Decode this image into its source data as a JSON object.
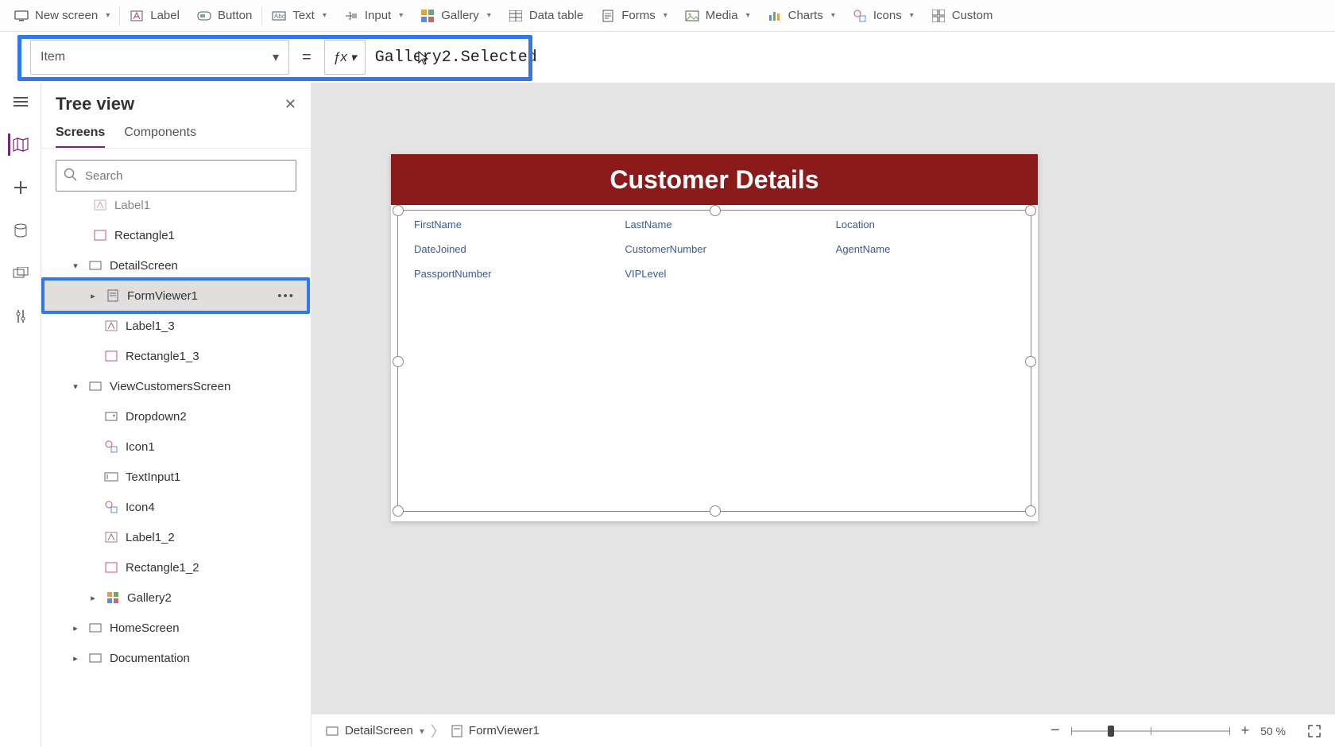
{
  "ribbon": {
    "new_screen": "New screen",
    "label": "Label",
    "button": "Button",
    "text": "Text",
    "input": "Input",
    "gallery": "Gallery",
    "datatable": "Data table",
    "forms": "Forms",
    "media": "Media",
    "charts": "Charts",
    "icons": "Icons",
    "custom": "Custom"
  },
  "formula": {
    "property": "Item",
    "value": "Gallery2.Selected"
  },
  "tree": {
    "title": "Tree view",
    "tab_screens": "Screens",
    "tab_components": "Components",
    "search_placeholder": "Search",
    "nodes": {
      "label1": "Label1",
      "rectangle1": "Rectangle1",
      "detailscreen": "DetailScreen",
      "formviewer1": "FormViewer1",
      "label1_3": "Label1_3",
      "rectangle1_3": "Rectangle1_3",
      "viewcustomers": "ViewCustomersScreen",
      "dropdown2": "Dropdown2",
      "icon1": "Icon1",
      "textinput1": "TextInput1",
      "icon4": "Icon4",
      "label1_2": "Label1_2",
      "rectangle1_2": "Rectangle1_2",
      "gallery2": "Gallery2",
      "homescreen": "HomeScreen",
      "documentation": "Documentation"
    }
  },
  "canvas": {
    "header": "Customer Details",
    "fields": {
      "r1c1": "FirstName",
      "r1c2": "LastName",
      "r1c3": "Location",
      "r2c1": "DateJoined",
      "r2c2": "CustomerNumber",
      "r2c3": "AgentName",
      "r3c1": "PassportNumber",
      "r3c2": "VIPLevel"
    }
  },
  "bottom": {
    "crumb1": "DetailScreen",
    "crumb2": "FormViewer1",
    "zoom": "50",
    "pct": "%"
  }
}
